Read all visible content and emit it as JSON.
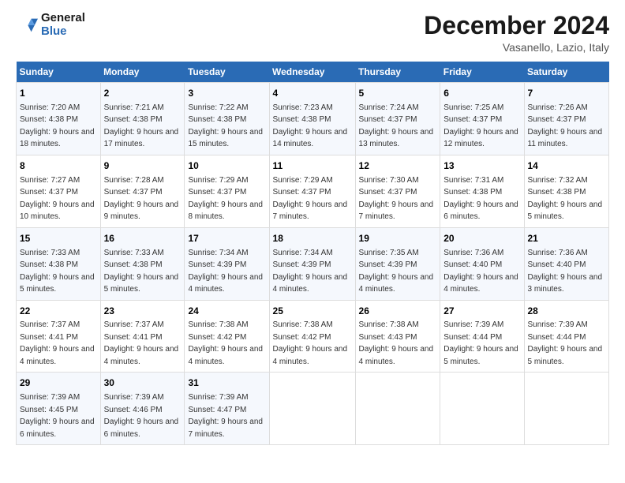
{
  "header": {
    "logo_line1": "General",
    "logo_line2": "Blue",
    "month_title": "December 2024",
    "location": "Vasanello, Lazio, Italy"
  },
  "weekdays": [
    "Sunday",
    "Monday",
    "Tuesday",
    "Wednesday",
    "Thursday",
    "Friday",
    "Saturday"
  ],
  "weeks": [
    [
      {
        "day": "1",
        "sunrise": "Sunrise: 7:20 AM",
        "sunset": "Sunset: 4:38 PM",
        "daylight": "Daylight: 9 hours and 18 minutes."
      },
      {
        "day": "2",
        "sunrise": "Sunrise: 7:21 AM",
        "sunset": "Sunset: 4:38 PM",
        "daylight": "Daylight: 9 hours and 17 minutes."
      },
      {
        "day": "3",
        "sunrise": "Sunrise: 7:22 AM",
        "sunset": "Sunset: 4:38 PM",
        "daylight": "Daylight: 9 hours and 15 minutes."
      },
      {
        "day": "4",
        "sunrise": "Sunrise: 7:23 AM",
        "sunset": "Sunset: 4:38 PM",
        "daylight": "Daylight: 9 hours and 14 minutes."
      },
      {
        "day": "5",
        "sunrise": "Sunrise: 7:24 AM",
        "sunset": "Sunset: 4:37 PM",
        "daylight": "Daylight: 9 hours and 13 minutes."
      },
      {
        "day": "6",
        "sunrise": "Sunrise: 7:25 AM",
        "sunset": "Sunset: 4:37 PM",
        "daylight": "Daylight: 9 hours and 12 minutes."
      },
      {
        "day": "7",
        "sunrise": "Sunrise: 7:26 AM",
        "sunset": "Sunset: 4:37 PM",
        "daylight": "Daylight: 9 hours and 11 minutes."
      }
    ],
    [
      {
        "day": "8",
        "sunrise": "Sunrise: 7:27 AM",
        "sunset": "Sunset: 4:37 PM",
        "daylight": "Daylight: 9 hours and 10 minutes."
      },
      {
        "day": "9",
        "sunrise": "Sunrise: 7:28 AM",
        "sunset": "Sunset: 4:37 PM",
        "daylight": "Daylight: 9 hours and 9 minutes."
      },
      {
        "day": "10",
        "sunrise": "Sunrise: 7:29 AM",
        "sunset": "Sunset: 4:37 PM",
        "daylight": "Daylight: 9 hours and 8 minutes."
      },
      {
        "day": "11",
        "sunrise": "Sunrise: 7:29 AM",
        "sunset": "Sunset: 4:37 PM",
        "daylight": "Daylight: 9 hours and 7 minutes."
      },
      {
        "day": "12",
        "sunrise": "Sunrise: 7:30 AM",
        "sunset": "Sunset: 4:37 PM",
        "daylight": "Daylight: 9 hours and 7 minutes."
      },
      {
        "day": "13",
        "sunrise": "Sunrise: 7:31 AM",
        "sunset": "Sunset: 4:38 PM",
        "daylight": "Daylight: 9 hours and 6 minutes."
      },
      {
        "day": "14",
        "sunrise": "Sunrise: 7:32 AM",
        "sunset": "Sunset: 4:38 PM",
        "daylight": "Daylight: 9 hours and 5 minutes."
      }
    ],
    [
      {
        "day": "15",
        "sunrise": "Sunrise: 7:33 AM",
        "sunset": "Sunset: 4:38 PM",
        "daylight": "Daylight: 9 hours and 5 minutes."
      },
      {
        "day": "16",
        "sunrise": "Sunrise: 7:33 AM",
        "sunset": "Sunset: 4:38 PM",
        "daylight": "Daylight: 9 hours and 5 minutes."
      },
      {
        "day": "17",
        "sunrise": "Sunrise: 7:34 AM",
        "sunset": "Sunset: 4:39 PM",
        "daylight": "Daylight: 9 hours and 4 minutes."
      },
      {
        "day": "18",
        "sunrise": "Sunrise: 7:34 AM",
        "sunset": "Sunset: 4:39 PM",
        "daylight": "Daylight: 9 hours and 4 minutes."
      },
      {
        "day": "19",
        "sunrise": "Sunrise: 7:35 AM",
        "sunset": "Sunset: 4:39 PM",
        "daylight": "Daylight: 9 hours and 4 minutes."
      },
      {
        "day": "20",
        "sunrise": "Sunrise: 7:36 AM",
        "sunset": "Sunset: 4:40 PM",
        "daylight": "Daylight: 9 hours and 4 minutes."
      },
      {
        "day": "21",
        "sunrise": "Sunrise: 7:36 AM",
        "sunset": "Sunset: 4:40 PM",
        "daylight": "Daylight: 9 hours and 3 minutes."
      }
    ],
    [
      {
        "day": "22",
        "sunrise": "Sunrise: 7:37 AM",
        "sunset": "Sunset: 4:41 PM",
        "daylight": "Daylight: 9 hours and 4 minutes."
      },
      {
        "day": "23",
        "sunrise": "Sunrise: 7:37 AM",
        "sunset": "Sunset: 4:41 PM",
        "daylight": "Daylight: 9 hours and 4 minutes."
      },
      {
        "day": "24",
        "sunrise": "Sunrise: 7:38 AM",
        "sunset": "Sunset: 4:42 PM",
        "daylight": "Daylight: 9 hours and 4 minutes."
      },
      {
        "day": "25",
        "sunrise": "Sunrise: 7:38 AM",
        "sunset": "Sunset: 4:42 PM",
        "daylight": "Daylight: 9 hours and 4 minutes."
      },
      {
        "day": "26",
        "sunrise": "Sunrise: 7:38 AM",
        "sunset": "Sunset: 4:43 PM",
        "daylight": "Daylight: 9 hours and 4 minutes."
      },
      {
        "day": "27",
        "sunrise": "Sunrise: 7:39 AM",
        "sunset": "Sunset: 4:44 PM",
        "daylight": "Daylight: 9 hours and 5 minutes."
      },
      {
        "day": "28",
        "sunrise": "Sunrise: 7:39 AM",
        "sunset": "Sunset: 4:44 PM",
        "daylight": "Daylight: 9 hours and 5 minutes."
      }
    ],
    [
      {
        "day": "29",
        "sunrise": "Sunrise: 7:39 AM",
        "sunset": "Sunset: 4:45 PM",
        "daylight": "Daylight: 9 hours and 6 minutes."
      },
      {
        "day": "30",
        "sunrise": "Sunrise: 7:39 AM",
        "sunset": "Sunset: 4:46 PM",
        "daylight": "Daylight: 9 hours and 6 minutes."
      },
      {
        "day": "31",
        "sunrise": "Sunrise: 7:39 AM",
        "sunset": "Sunset: 4:47 PM",
        "daylight": "Daylight: 9 hours and 7 minutes."
      },
      null,
      null,
      null,
      null
    ]
  ]
}
